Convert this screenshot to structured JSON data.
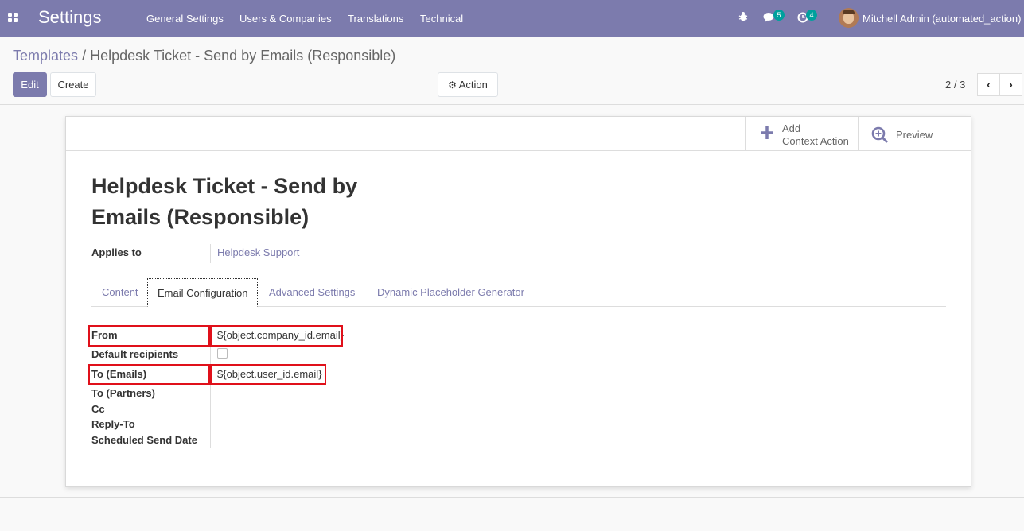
{
  "navbar": {
    "brand": "Settings",
    "menu": [
      "General Settings",
      "Users & Companies",
      "Translations",
      "Technical"
    ],
    "messages_count": "5",
    "activities_count": "4",
    "user": "Mitchell Admin (automated_action)"
  },
  "breadcrumb": {
    "parent": "Templates",
    "separator": "/",
    "current": "Helpdesk Ticket - Send by Emails (Responsible)"
  },
  "buttons": {
    "edit": "Edit",
    "create": "Create",
    "action": "Action"
  },
  "pager": {
    "value": "2 / 3"
  },
  "smart_buttons": {
    "add_line1": "Add",
    "add_line2": "Context Action",
    "preview": "Preview"
  },
  "record": {
    "title_line1": "Helpdesk Ticket - Send by",
    "title_line2": "Emails (Responsible)",
    "applies_to_label": "Applies to",
    "applies_to_value": "Helpdesk Support"
  },
  "tabs": [
    "Content",
    "Email Configuration",
    "Advanced Settings",
    "Dynamic Placeholder Generator"
  ],
  "email_config": {
    "from_label": "From",
    "from_value": "${object.company_id.email}",
    "default_recipients_label": "Default recipients",
    "to_emails_label": "To (Emails)",
    "to_emails_value": "${object.user_id.email}",
    "to_partners_label": "To (Partners)",
    "cc_label": "Cc",
    "reply_to_label": "Reply-To",
    "scheduled_label": "Scheduled Send Date"
  },
  "colors": {
    "brand": "#7c7bad",
    "badge": "#00a09d",
    "highlight": "#e0101a"
  }
}
